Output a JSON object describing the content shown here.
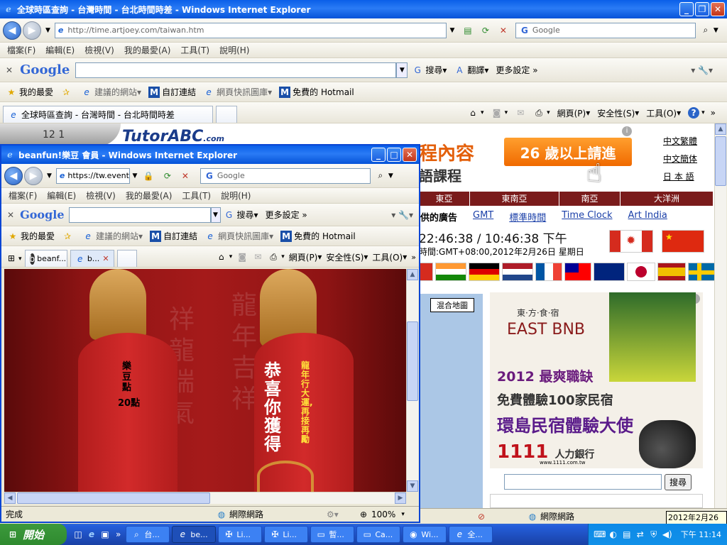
{
  "back_window": {
    "title": "全球時區查詢 - 台灣時間 - 台北時間時差 - Windows Internet Explorer",
    "address": "http://time.artjoey.com/taiwan.htm",
    "search_placeholder": "Google",
    "menu": [
      "檔案(F)",
      "編輯(E)",
      "檢視(V)",
      "我的最愛(A)",
      "工具(T)",
      "說明(H)"
    ],
    "google_bar": {
      "logo": "Google",
      "search": "搜尋",
      "translate": "翻譯",
      "more": "更多設定 »"
    },
    "favorites_bar": {
      "favorites": "我的最愛",
      "suggested": "建議的網站",
      "custom_links": "自訂連結",
      "web_slice": "網頁快訊圖庫",
      "hotmail": "免費的 Hotmail"
    },
    "tab": "全球時區查詢 - 台灣時間 - 台北時間時差",
    "command_bar": {
      "page": "網頁(P)",
      "safety": "安全性(S)",
      "tools": "工具(O)"
    },
    "content": {
      "logo_text": "TutorABC",
      "logo_suffix": ".com",
      "course_text": "程內容",
      "course_text2": "語課程",
      "ad_banner": "26 歲以上請進",
      "lang_links": [
        "中文繁體",
        "中文簡体",
        "日 本 語"
      ],
      "regions": [
        "東亞",
        "東南亞",
        "南亞",
        "大洋洲"
      ],
      "links": {
        "ad": "供的廣告",
        "gmt": "GMT",
        "standard_time": "標準時間",
        "time_clock": "Time Clock",
        "art_india": "Art India"
      },
      "clock": "22:46:38 / 10:46:38 下午",
      "tz_info": "時間:GMT+08:00,2012年2月26日 星期日",
      "map_btn": "混合地圖",
      "ad2": {
        "brand_small": "東·方·食·宿",
        "brand": "EAST BNB",
        "line1": "2012 最爽職缺",
        "line2": "免費體驗100家民宿",
        "line3": "環島民宿體驗大使",
        "bank": "1111",
        "bank_label": "人力銀行",
        "bank_url": "www.1111.com.tw"
      },
      "search_btn": "搜尋"
    },
    "status": {
      "zone": "網際網路"
    }
  },
  "front_window": {
    "title": "beanfun!樂豆 會員 - Windows Internet Explorer",
    "address": "https://tw.event.b",
    "search_placeholder": "Google",
    "menu": [
      "檔案(F)",
      "編輯(E)",
      "檢視(V)",
      "我的最愛(A)",
      "工具(T)",
      "說明(H)"
    ],
    "google_bar": {
      "logo": "Google",
      "search": "搜尋",
      "more": "更多設定 »"
    },
    "favorites_bar": {
      "favorites": "我的最愛",
      "suggested": "建議的網站",
      "custom_links": "自訂連結",
      "web_slice": "網頁快訊圖庫",
      "hotmail": "免費的 Hotmail"
    },
    "tabs": [
      "beanf...",
      "b..."
    ],
    "command_bar": {
      "page": "網頁(P)",
      "safety": "安全性(S)",
      "tools": "工具(O)"
    },
    "content": {
      "tag1": "樂豆點",
      "tag1_points": "20點",
      "tag2_main": "恭喜你獲得",
      "tag2_side": "龍年行大運,再接再勵",
      "bg_text1": "祥龍瑞氣",
      "bg_text2": "龍年吉祥"
    },
    "status": {
      "done": "完成",
      "zone": "網際網路",
      "zoom": "100%"
    }
  },
  "taskbar": {
    "start": "開始",
    "tasks": [
      "台...",
      "be...",
      "Li...",
      "Li...",
      "暫...",
      "Ca...",
      "Wi...",
      "全..."
    ],
    "date_tooltip": "2012年2月26日",
    "time": "下午 11:14"
  }
}
